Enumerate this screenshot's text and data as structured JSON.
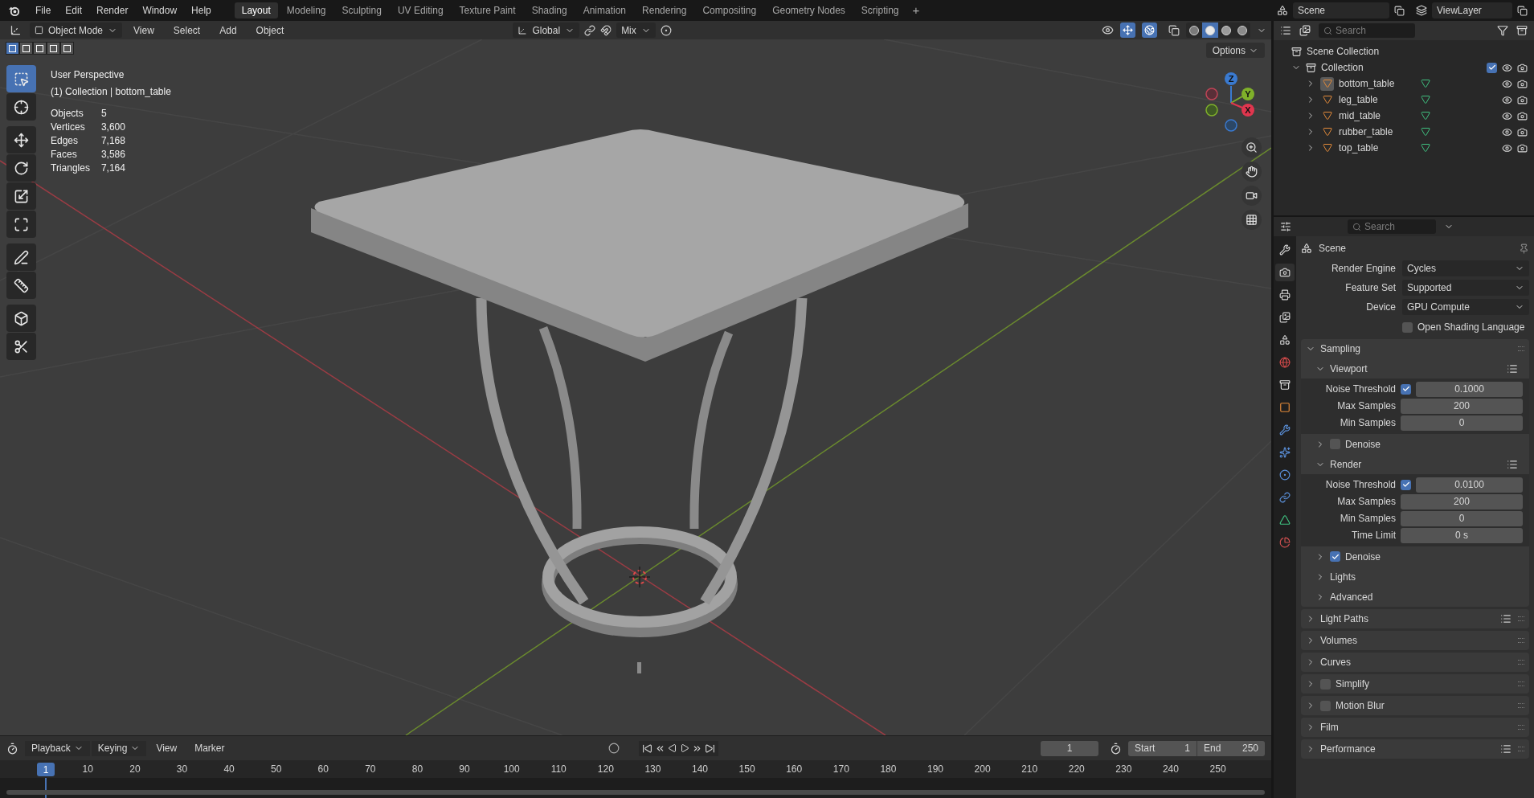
{
  "menu": [
    "File",
    "Edit",
    "Render",
    "Window",
    "Help"
  ],
  "workspaces": [
    {
      "label": "Layout",
      "selected": true
    },
    {
      "label": "Modeling",
      "selected": false
    },
    {
      "label": "Sculpting",
      "selected": false
    },
    {
      "label": "UV Editing",
      "selected": false
    },
    {
      "label": "Texture Paint",
      "selected": false
    },
    {
      "label": "Shading",
      "selected": false
    },
    {
      "label": "Animation",
      "selected": false
    },
    {
      "label": "Rendering",
      "selected": false
    },
    {
      "label": "Compositing",
      "selected": false
    },
    {
      "label": "Geometry Nodes",
      "selected": false
    },
    {
      "label": "Scripting",
      "selected": false
    }
  ],
  "add_workspace": "+",
  "scene": {
    "name": "Scene",
    "view_layer": "ViewLayer"
  },
  "viewport_header": {
    "mode": "Object Mode",
    "menus": [
      "View",
      "Select",
      "Add",
      "Object"
    ],
    "orientation": "Global",
    "snapping": "Mix",
    "gizmos_on": true,
    "overlays_on": true,
    "shading": [
      {
        "kind": "wireframe",
        "selected": false
      },
      {
        "kind": "solid",
        "selected": true
      },
      {
        "kind": "material",
        "selected": false
      },
      {
        "kind": "rendered",
        "selected": false
      }
    ]
  },
  "select_modes": [
    {
      "selected": true
    },
    {
      "selected": false
    },
    {
      "selected": false
    },
    {
      "selected": false
    },
    {
      "selected": false
    }
  ],
  "options": "Options",
  "overlay": {
    "view_name": "User Perspective",
    "context": "(1) Collection | bottom_table",
    "stats": [
      {
        "label": "Objects",
        "value": "5"
      },
      {
        "label": "Vertices",
        "value": "3,600"
      },
      {
        "label": "Edges",
        "value": "7,168"
      },
      {
        "label": "Faces",
        "value": "3,586"
      },
      {
        "label": "Triangles",
        "value": "7,164"
      }
    ]
  },
  "gizmo": {
    "z": "Z",
    "y": "Y",
    "x": "X"
  },
  "tools": [
    {
      "kind": "select",
      "selected": true
    },
    {
      "kind": "cursor",
      "selected": false
    },
    {
      "kind": "move",
      "selected": false
    },
    {
      "kind": "rotate",
      "selected": false
    },
    {
      "kind": "scale",
      "selected": false
    },
    {
      "kind": "transform",
      "selected": false
    },
    {
      "kind": "annotate",
      "selected": false
    },
    {
      "kind": "measure",
      "selected": false
    },
    {
      "kind": "add_cube",
      "selected": false
    },
    {
      "kind": "cut",
      "selected": false
    }
  ],
  "outliner": {
    "search_placeholder": "Search",
    "root": "Scene Collection",
    "collection": {
      "label": "Collection",
      "expanded": true,
      "checked": true,
      "children": [
        {
          "label": "bottom_table",
          "selected": true
        },
        {
          "label": "leg_table",
          "selected": false
        },
        {
          "label": "mid_table",
          "selected": false
        },
        {
          "label": "rubber_table",
          "selected": false
        },
        {
          "label": "top_table",
          "selected": false
        }
      ]
    }
  },
  "properties": {
    "search_placeholder": "Search",
    "context": "Scene",
    "tabs": [
      {
        "kind": "tool",
        "selected": false
      },
      {
        "kind": "render",
        "selected": true
      },
      {
        "kind": "output",
        "selected": false
      },
      {
        "kind": "view_layer",
        "selected": false
      },
      {
        "kind": "scene",
        "selected": false
      },
      {
        "kind": "world",
        "selected": false
      },
      {
        "kind": "collection",
        "selected": false
      },
      {
        "kind": "object",
        "selected": false
      },
      {
        "kind": "modifier",
        "selected": false
      },
      {
        "kind": "particles",
        "selected": false
      },
      {
        "kind": "physics",
        "selected": false
      },
      {
        "kind": "constraints",
        "selected": false
      },
      {
        "kind": "data",
        "selected": false
      },
      {
        "kind": "material",
        "selected": false
      }
    ],
    "fields": [
      {
        "label": "Render Engine",
        "value": "Cycles"
      },
      {
        "label": "Feature Set",
        "value": "Supported"
      },
      {
        "label": "Device",
        "value": "GPU Compute"
      }
    ],
    "osl": {
      "label": "Open Shading Language",
      "checked": false
    },
    "panels": [
      {
        "label": "Sampling",
        "expanded": true,
        "presets": false,
        "children": [
          {
            "label": "Viewport",
            "expanded": true,
            "presets": true,
            "rows": [
              {
                "kind": "toggle_number",
                "label": "Noise Threshold",
                "checked": true,
                "value": "0.1000"
              },
              {
                "kind": "number",
                "label": "Max Samples",
                "value": "200"
              },
              {
                "kind": "number",
                "label": "Min Samples",
                "value": "0"
              }
            ]
          },
          {
            "label": "Denoise",
            "expanded": false,
            "presets": false,
            "checked": false
          },
          {
            "label": "Render",
            "expanded": true,
            "presets": true,
            "rows": [
              {
                "kind": "toggle_number",
                "label": "Noise Threshold",
                "checked": true,
                "value": "0.0100"
              },
              {
                "kind": "number",
                "label": "Max Samples",
                "value": "200"
              },
              {
                "kind": "number",
                "label": "Min Samples",
                "value": "0"
              },
              {
                "kind": "number",
                "label": "Time Limit",
                "value": "0 s"
              }
            ]
          },
          {
            "label": "Denoise",
            "expanded": false,
            "presets": false,
            "checked": true
          },
          {
            "label": "Lights",
            "expanded": false,
            "presets": false
          },
          {
            "label": "Advanced",
            "expanded": false,
            "presets": false
          }
        ]
      },
      {
        "label": "Light Paths",
        "expanded": false,
        "presets": true
      },
      {
        "label": "Volumes",
        "expanded": false,
        "presets": false
      },
      {
        "label": "Curves",
        "expanded": false,
        "presets": false
      },
      {
        "label": "Simplify",
        "expanded": false,
        "presets": false,
        "checked": false
      },
      {
        "label": "Motion Blur",
        "expanded": false,
        "presets": false,
        "checked": false
      },
      {
        "label": "Film",
        "expanded": false,
        "presets": false
      },
      {
        "label": "Performance",
        "expanded": false,
        "presets": true
      }
    ]
  },
  "timeline": {
    "menus": [
      "Playback",
      "Keying",
      "View",
      "Marker"
    ],
    "frame": "1",
    "start_label": "Start",
    "start": "1",
    "end_label": "End",
    "end": "250",
    "current": "1",
    "ticks": [
      "10",
      "20",
      "30",
      "40",
      "50",
      "60",
      "70",
      "80",
      "90",
      "100",
      "110",
      "120",
      "130",
      "140",
      "150",
      "160",
      "170",
      "180",
      "190",
      "200",
      "210",
      "220",
      "230",
      "240",
      "250"
    ]
  }
}
